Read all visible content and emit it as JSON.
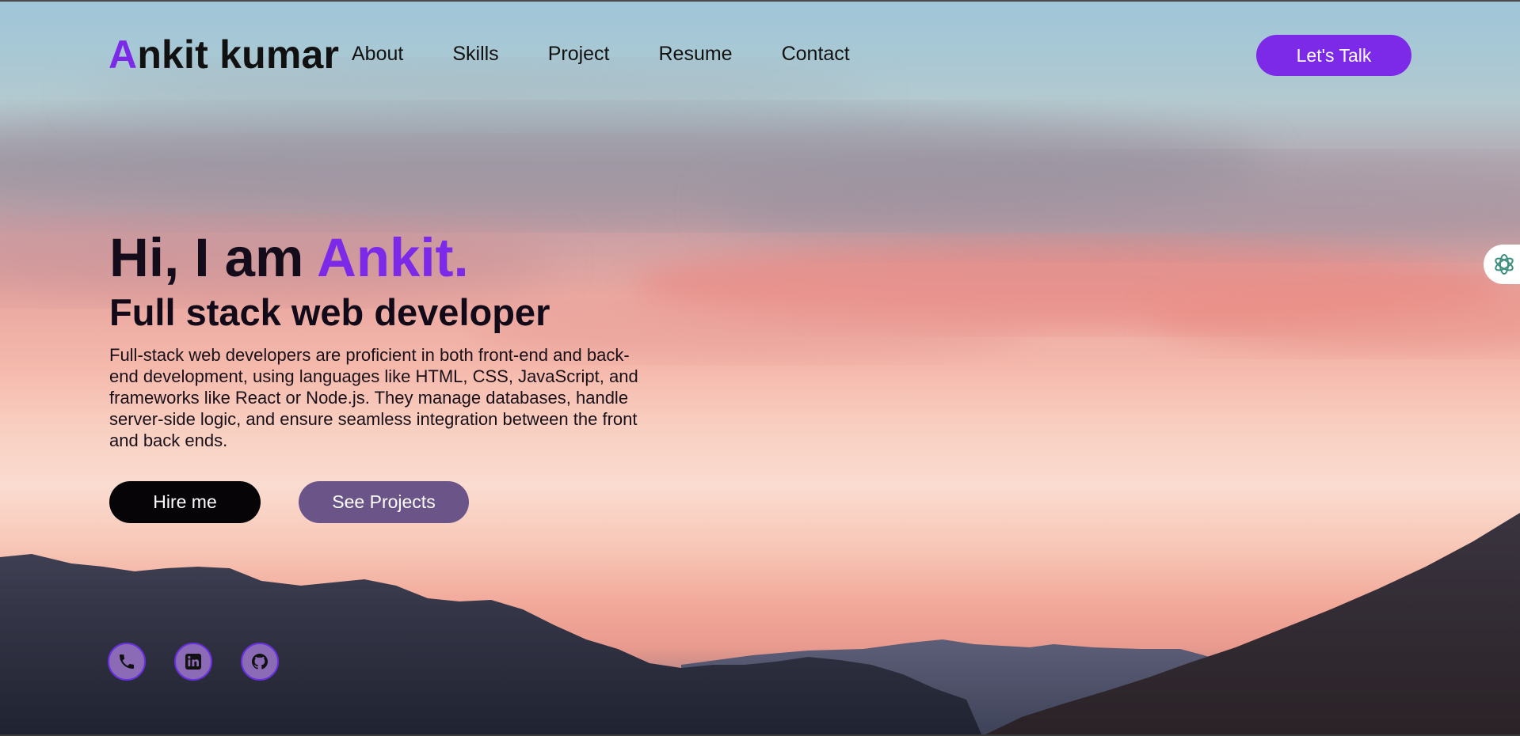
{
  "nav": {
    "logo_accent": "A",
    "logo_rest": "nkit kumar",
    "links": [
      "About",
      "Skills",
      "Project",
      "Resume",
      "Contact"
    ],
    "cta_label": "Let's Talk"
  },
  "hero": {
    "greeting": "Hi, I am ",
    "name": "Ankit.",
    "subtitle": "Full stack web developer",
    "description": "Full-stack web developers are proficient in both front-end and back-end development, using languages like HTML, CSS, JavaScript, and frameworks like React or Node.js. They manage databases, handle server-side logic, and ensure seamless integration between the front and back ends.",
    "hire_label": "Hire me",
    "projects_label": "See Projects"
  },
  "socials": [
    {
      "icon": "phone-icon"
    },
    {
      "icon": "linkedin-icon"
    },
    {
      "icon": "github-icon"
    }
  ],
  "side_widget": {
    "icon": "chatgpt-icon"
  },
  "colors": {
    "accent": "#7c2ae8",
    "hire_bg": "#060406",
    "projects_bg": "#6a5488",
    "social_bg": "#8b6bb5"
  }
}
